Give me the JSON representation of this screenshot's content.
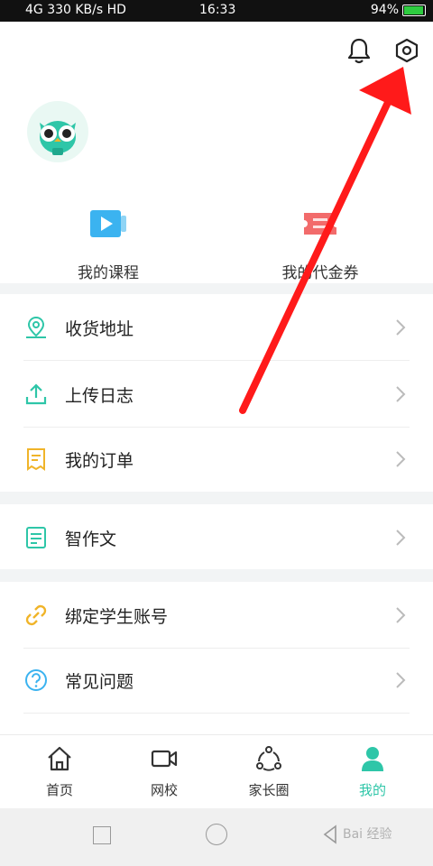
{
  "status_bar": {
    "left": "4G 330 KB/s HD",
    "time": "16:33",
    "battery": "94%"
  },
  "shortcuts": [
    {
      "label": "我的课程",
      "icon": "play-video-icon"
    },
    {
      "label": "我的代金券",
      "icon": "ticket-icon"
    }
  ],
  "menu": {
    "address": "收货地址",
    "upload_log": "上传日志",
    "orders": "我的订单",
    "composition": "智作文",
    "bind_student": "绑定学生账号",
    "faq": "常见问题"
  },
  "tabs": [
    {
      "label": "首页",
      "icon": "home-icon"
    },
    {
      "label": "网校",
      "icon": "video-camera-icon"
    },
    {
      "label": "家长圈",
      "icon": "community-icon"
    },
    {
      "label": "我的",
      "icon": "person-icon"
    }
  ],
  "colors": {
    "accent": "#2ec6a8",
    "course_blue": "#3bb3f0",
    "coupon_red": "#f26b6b",
    "order_yellow": "#f0b429",
    "link_yellow": "#f0b429",
    "faq_blue": "#3bb3f0",
    "annotation_arrow": "#ff1a1a"
  },
  "watermark": "Bai 经验"
}
